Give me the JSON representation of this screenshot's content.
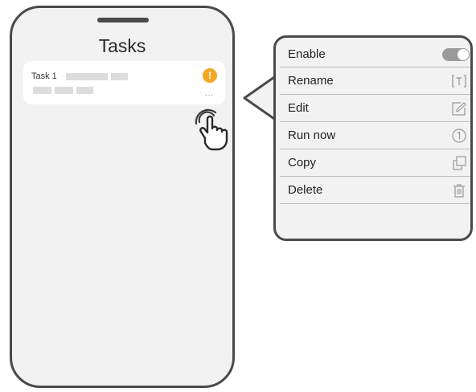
{
  "screen": {
    "title": "Tasks",
    "task": {
      "name": "Task 1",
      "status_icon": "alert-icon",
      "more_icon": "more-options-icon",
      "more_label": "..."
    }
  },
  "menu": {
    "items": [
      {
        "label": "Enable",
        "icon": "toggle-switch",
        "toggle_on": true
      },
      {
        "label": "Rename",
        "icon": "rename-icon",
        "icon_text": "[T]"
      },
      {
        "label": "Edit",
        "icon": "edit-icon"
      },
      {
        "label": "Run now",
        "icon": "run-now-icon",
        "icon_text": "1"
      },
      {
        "label": "Copy",
        "icon": "copy-icon"
      },
      {
        "label": "Delete",
        "icon": "trash-icon"
      }
    ]
  },
  "colors": {
    "alert": "#f5a623",
    "outline": "#4a4a4a",
    "panel": "#f2f2f2"
  }
}
